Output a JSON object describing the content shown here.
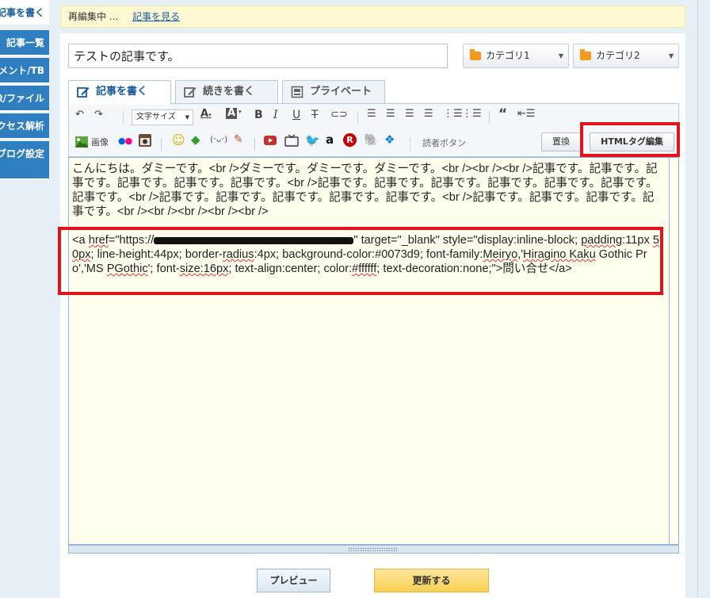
{
  "sidebar": {
    "items": [
      {
        "label": "記事を書く"
      },
      {
        "label": "記事一覧"
      },
      {
        "label": "コメント/TB"
      },
      {
        "label": "画像/ファイル"
      },
      {
        "label": "アクセス解析"
      },
      {
        "label": "ブログ設定"
      }
    ]
  },
  "notice": {
    "status": "再編集中 ...",
    "link": "記事を見る"
  },
  "title_input": {
    "value": "テストの記事です。"
  },
  "categories": [
    {
      "label": "カテゴリ1"
    },
    {
      "label": "カテゴリ2"
    }
  ],
  "tabs": [
    {
      "label": "記事を書く"
    },
    {
      "label": "続きを書く"
    },
    {
      "label": "プライベート"
    }
  ],
  "toolbar": {
    "font_size_label": "文字サイズ",
    "image_label": "画像",
    "reader_button_label": "読者ボタン",
    "replace_label": "置換",
    "html_edit_label": "HTMLタグ編集"
  },
  "editor": {
    "paragraph1": "こんにちは。ダミーです。<br />ダミーです。ダミーです。ダミーです。<br /><br /><br />記事です。記事です。記事です。記事です。記事です。記事です。<br />記事です。記事です。記事です。記事です。記事です。記事です。記事です。<br />記事です。記事です。記事です。記事です。記事です。<br />記事です。記事です。記事です。記事です。<br /><br /><br /><br /><br />",
    "code_a": "<a ",
    "code_href": "href",
    "code_href_open": "=\"https://",
    "code_after_url": "\" target=\"_blank\" style=\"display:inline-block; ",
    "code_padding": "padding",
    "code_px1": ":11px ",
    "code_50px": "50px",
    "code_lh": "; line-height:44px; border-",
    "code_radius": "radius",
    "code_bg": ":4px; background-color:#0073d9; font-family:",
    "code_meiryo": "Meiryo",
    "code_hira_q": ",'",
    "code_hira": "Hiragino Kaku",
    "code_gothic": " Gothic Pro','MS ",
    "code_pgothic": "PGothic",
    "code_fs_pre": "'; font-",
    "code_fs": "size:16px",
    "code_align": "; text-align:center; color:",
    "code_ffffff": "#ffffff",
    "code_tail": "; text-decoration:none;\">問い合せ</a>"
  },
  "buttons": {
    "preview": "プレビュー",
    "update": "更新する"
  },
  "colors": {
    "accent": "#2f7fc0",
    "highlight_border": "#e0141a",
    "editor_bg": "#ffffee",
    "update_button": "#f7cf52"
  }
}
